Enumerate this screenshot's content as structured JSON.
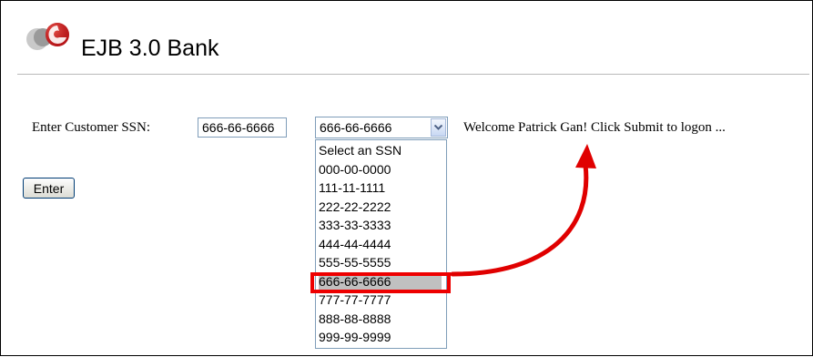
{
  "app": {
    "title": "EJB 3.0 Bank"
  },
  "form": {
    "ssn_label": "Enter Customer SSN:",
    "ssn_value": "666-66-6666",
    "select_value": "666-66-6666",
    "welcome_message": "Welcome Patrick Gan! Click Submit to logon ...",
    "enter_label": "Enter"
  },
  "dropdown": {
    "options": [
      "Select an SSN",
      "000-00-0000",
      "111-11-1111",
      "222-22-2222",
      "333-33-3333",
      "444-44-4444",
      "555-55-5555",
      "666-66-6666",
      "777-77-7777",
      "888-88-8888",
      "999-99-9999"
    ],
    "selected_index": 7
  },
  "colors": {
    "highlight": "#e00000",
    "arrow": "#e00000",
    "selected_bg": "#c0c0c0"
  },
  "icons": {
    "logo": "bank-logo-icon",
    "dropdown": "chevron-down-icon"
  }
}
